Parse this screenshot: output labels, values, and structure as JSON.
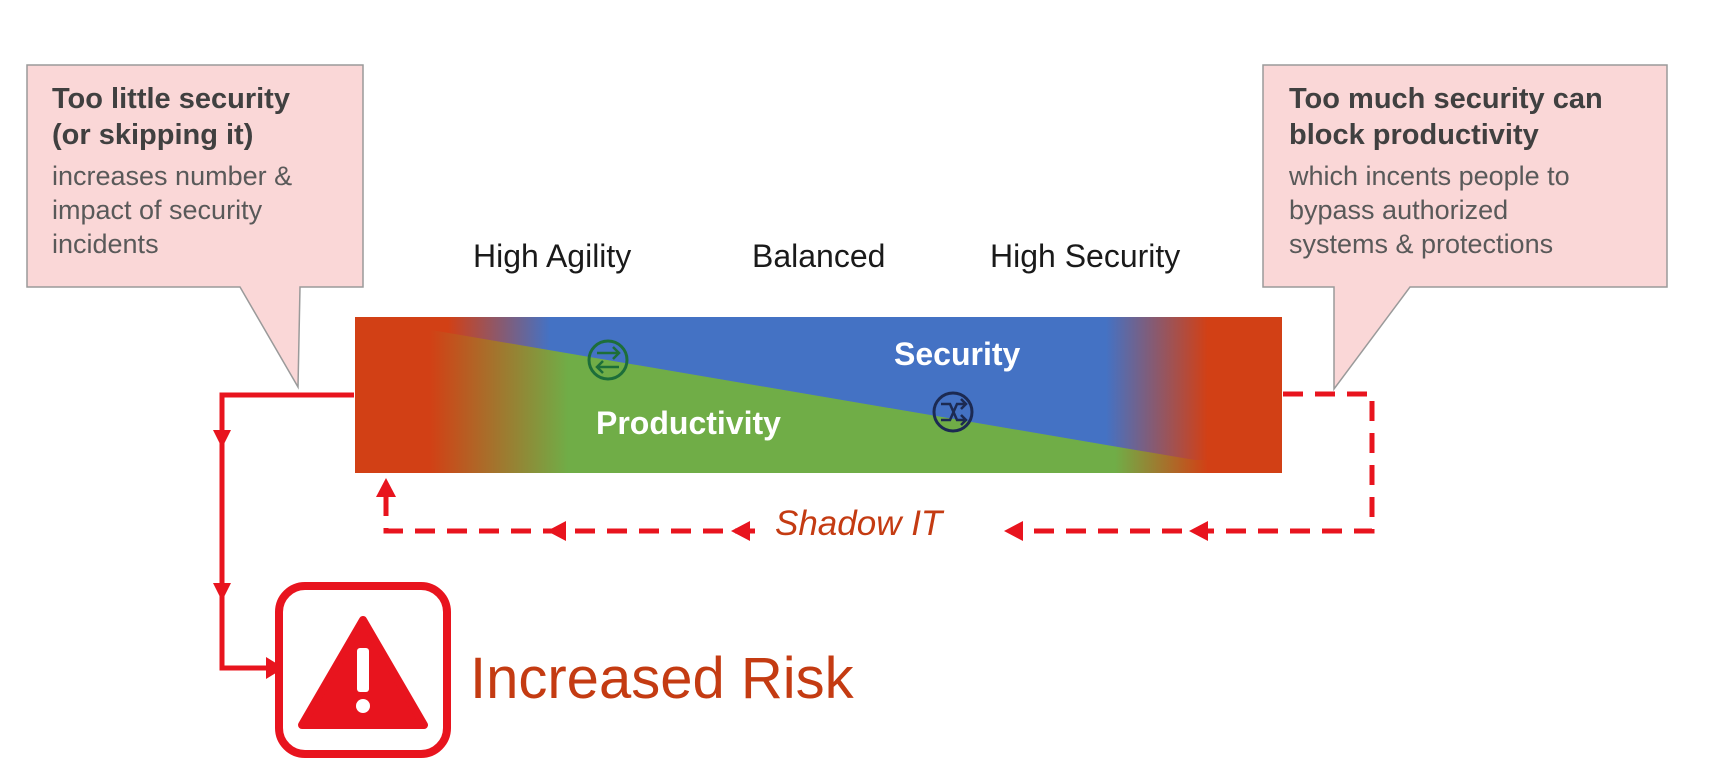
{
  "left_callout": {
    "title_line1": "Too little security",
    "title_line2": "(or skipping it)",
    "body_line1": "increases number &",
    "body_line2": "impact of security",
    "body_line3": "incidents"
  },
  "right_callout": {
    "title_line1": "Too much security can",
    "title_line2": "block productivity",
    "body_line1": "which incents people to",
    "body_line2": "bypass authorized",
    "body_line3": "systems & protections"
  },
  "zones": {
    "left": "High Agility",
    "middle": "Balanced",
    "right": "High Security"
  },
  "band": {
    "security_label": "Security",
    "productivity_label": "Productivity"
  },
  "shadow_it_label": "Shadow IT",
  "risk_label": "Increased Risk",
  "colors": {
    "risk_red": "#e8141e",
    "risk_text": "#c43b12",
    "band_orange": "#d24015",
    "band_blue": "#4472c4",
    "band_green": "#70ad47",
    "callout_fill": "#fad7d7",
    "callout_border": "#9a9a9a"
  },
  "icons": {
    "balanced_icon": "arrows-exchange-icon",
    "high_security_icon": "shuffle-icon",
    "risk_icon": "warning-triangle-icon"
  }
}
